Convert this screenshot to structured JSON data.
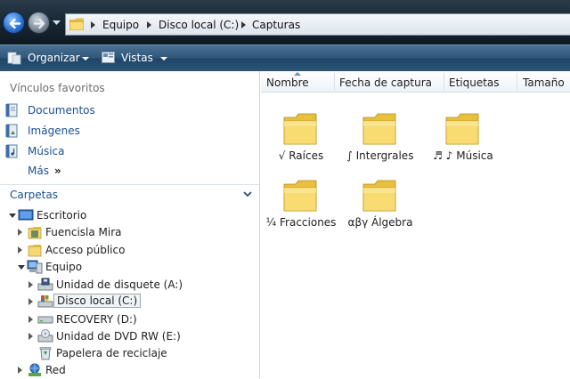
{
  "address_bar": {
    "crumbs": [
      "Equipo",
      "Disco local (C:)",
      "Capturas"
    ]
  },
  "command_bar": {
    "organize_label": "Organizar",
    "views_label": "Vistas"
  },
  "nav_pane": {
    "favorites_title": "Vínculos favoritos",
    "favorites": [
      {
        "label": "Documentos",
        "icon": "documents-icon"
      },
      {
        "label": "Imágenes",
        "icon": "pictures-icon"
      },
      {
        "label": "Música",
        "icon": "music-icon"
      }
    ],
    "more_label": "Más",
    "more_chevron": "»",
    "folders_title": "Carpetas",
    "tree": [
      {
        "label": "Escritorio",
        "icon": "desktop-icon"
      },
      {
        "label": "Fuencisla Mira",
        "icon": "user-folder-icon"
      },
      {
        "label": "Acceso público",
        "icon": "public-folder-icon"
      },
      {
        "label": "Equipo",
        "icon": "computer-icon"
      },
      {
        "label": "Unidad de disquete (A:)",
        "icon": "floppy-drive-icon"
      },
      {
        "label": "Disco local (C:)",
        "icon": "local-disk-icon"
      },
      {
        "label": "RECOVERY (D:)",
        "icon": "hard-drive-icon"
      },
      {
        "label": "Unidad de DVD RW (E:)",
        "icon": "dvd-drive-icon"
      },
      {
        "label": "Papelera de reciclaje",
        "icon": "recycle-bin-icon"
      },
      {
        "label": "Red",
        "icon": "network-icon"
      }
    ]
  },
  "content": {
    "columns": [
      "Nombre",
      "Fecha de captura",
      "Etiquetas",
      "Tamaño"
    ],
    "files": [
      {
        "label": "√ Raíces"
      },
      {
        "label": "∫ Intergrales"
      },
      {
        "label": "♬ ♪ Música"
      },
      {
        "label": "¼ Fracciones"
      },
      {
        "label": "αβγ Álgebra"
      }
    ]
  },
  "colors": {
    "link_blue": "#1a4f8f",
    "command_bar": "#2f5678",
    "folder_yellow": "#f6d66a"
  }
}
